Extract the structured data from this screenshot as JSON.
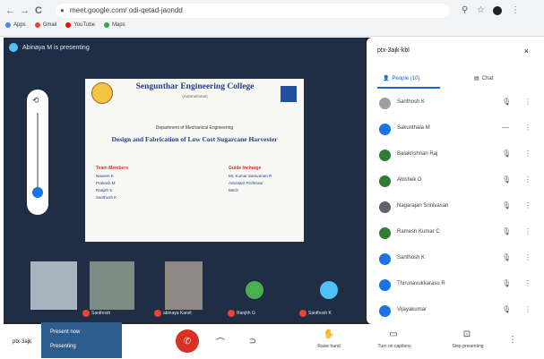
{
  "browser": {
    "back_icon": "←",
    "forward_icon": "→",
    "reload_icon": "C",
    "url": "meet.google.com/ odi-qetad-jaondd",
    "bookmarks": [
      {
        "label": "Apps",
        "color": "#4285f4"
      },
      {
        "label": "Gmail",
        "color": "#ea4335"
      },
      {
        "label": "YouTube",
        "color": "#ff0000"
      },
      {
        "label": "Maps",
        "color": "#34a853"
      }
    ]
  },
  "stage": {
    "presenter_text": "Abinaya M is presenting"
  },
  "slide": {
    "college": "Sengunthar Engineering College",
    "college_sub": "(Autonomous)",
    "department": "Department of Mechanical Engineering",
    "project": "Design and Fabrication of Low Cost Sugarcane Harvester",
    "members_heading": "Team Members",
    "guide_heading": "Guide Incharge",
    "members": [
      "Naveen K",
      "Prakash M",
      "Ranjith S",
      "Santhosh K"
    ],
    "guide": [
      "Mr. Kumar Saravanan R",
      "Assistant Professor",
      "Mech"
    ]
  },
  "tiles": [
    {
      "label": "",
      "color": "#a7b5c1"
    },
    {
      "label": "Santhosh",
      "color": "#7b8c85"
    },
    {
      "label": "abinaya Karsit",
      "color": "#8e8a83"
    },
    {
      "label": "Ranjith G",
      "color": "#4caf50"
    },
    {
      "label": "Santhosh K",
      "color": "#4fc3f7"
    }
  ],
  "panel": {
    "title": "ptx-3ajk-kbl",
    "close_icon": "×",
    "tab_people": "People (10)",
    "tab_chat": "Chat",
    "people": [
      {
        "name": "Santhosh K",
        "color": "#9aa0a6"
      },
      {
        "name": "Sakunthala M",
        "color": "#1a73e8"
      },
      {
        "name": "Balakrishnan Raj",
        "color": "#2e7d32"
      },
      {
        "name": "Abishek G",
        "color": "#2e7d32"
      },
      {
        "name": "Nagarajan Srinivasan",
        "color": "#5f6368"
      },
      {
        "name": "Ramesh Kumar C",
        "color": "#2e7d32"
      },
      {
        "name": "Santhosh K",
        "color": "#1a73e8"
      },
      {
        "name": "Thirunavukkarasu R",
        "color": "#1a73e8"
      },
      {
        "name": "Vijayakumar",
        "color": "#1a73e8"
      }
    ]
  },
  "bottom": {
    "left_text": "ptx-3ajk",
    "popup_1": "Present now",
    "popup_2": "Presenting",
    "labels": {
      "raise_hand": "Raise hand",
      "captions": "Turn on captions",
      "present": "Stop presenting"
    }
  }
}
